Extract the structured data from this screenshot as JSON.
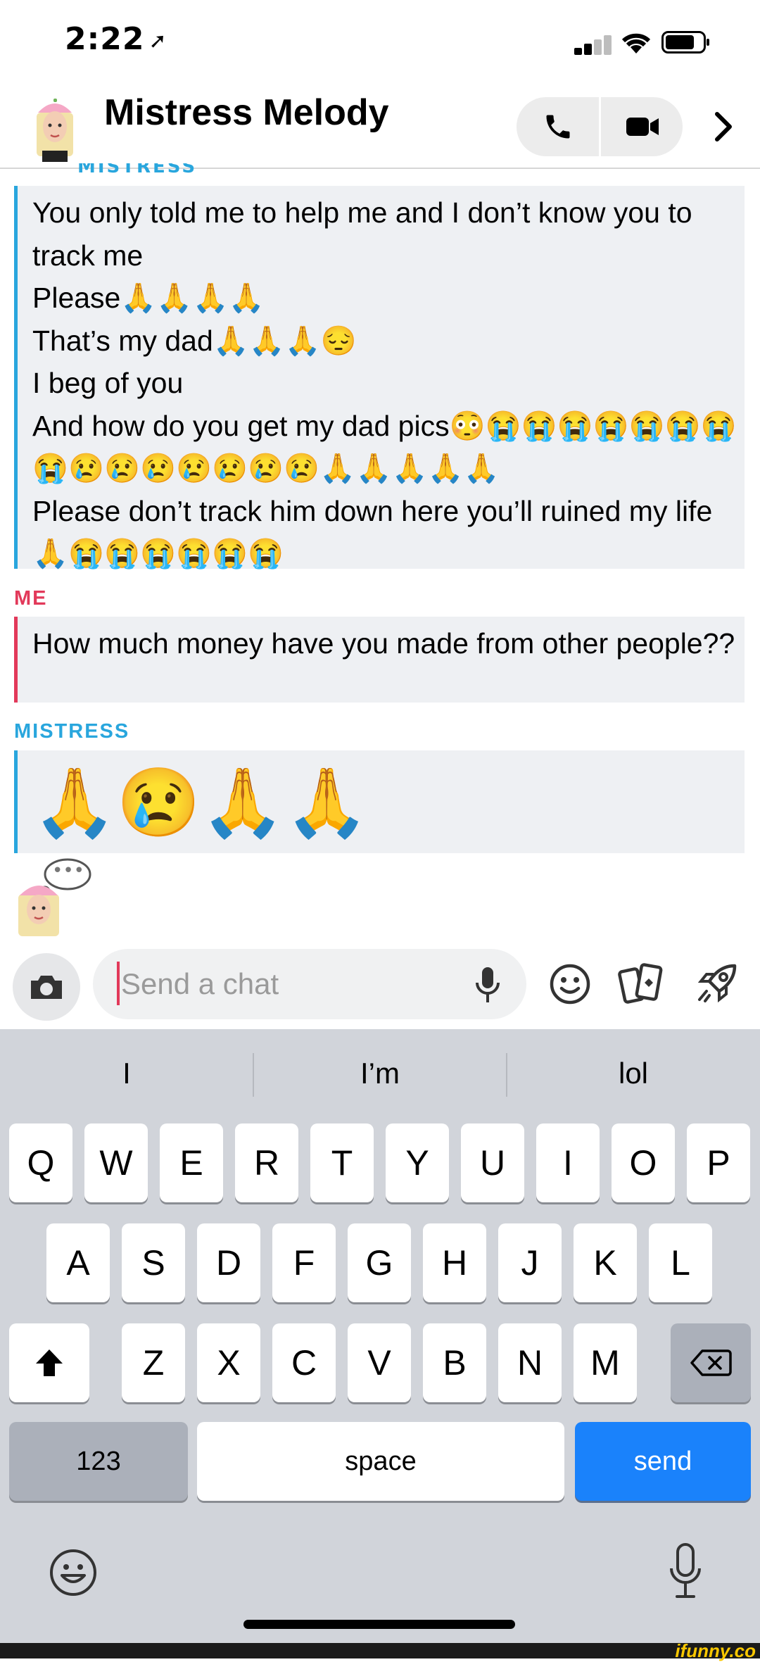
{
  "status_bar": {
    "time": "2:22",
    "location_arrow": "location-arrow-icon"
  },
  "header": {
    "title": "Mistress Melody",
    "partial_label": "MISTRESS",
    "icons": [
      "bitmoji-avatar-icon",
      "phone-icon",
      "video-camera-icon",
      "chevron-right-icon"
    ]
  },
  "messages": [
    {
      "sender": "MISTRESS",
      "color": "#29a6dd",
      "text": "You only told me to help me and I don’t know you to track me\nPlease🙏🙏🙏🙏\nThat’s my dad🙏🙏🙏😔\nI beg of you\nAnd how do you get my dad pics😳😭😭😭😭😭😭😭😭😢😢😢😢😢😢😢🙏🙏🙏🙏🙏\nPlease don’t track him down here you’ll ruined my life🙏😭😭😭😭😭😭"
    },
    {
      "sender": "ME",
      "color": "#e2395a",
      "text": "How much money have you made from other people??"
    },
    {
      "sender": "MISTRESS",
      "color": "#29a6dd",
      "text": "🙏😢🙏🙏"
    }
  ],
  "typing_indicator": {
    "dots": "•••"
  },
  "composer": {
    "placeholder": "Send a chat"
  },
  "keyboard": {
    "suggestions": [
      "I",
      "I’m",
      "lol"
    ],
    "row1": [
      "Q",
      "W",
      "E",
      "R",
      "T",
      "Y",
      "U",
      "I",
      "O",
      "P"
    ],
    "row2": [
      "A",
      "S",
      "D",
      "F",
      "G",
      "H",
      "J",
      "K",
      "L"
    ],
    "row3": [
      "Z",
      "X",
      "C",
      "V",
      "B",
      "N",
      "M"
    ],
    "numbers_label": "123",
    "space_label": "space",
    "send_label": "send"
  },
  "watermark": "ifunny.co",
  "colors": {
    "mistress": "#29a6dd",
    "me": "#e2395a",
    "send": "#1a82fb"
  }
}
